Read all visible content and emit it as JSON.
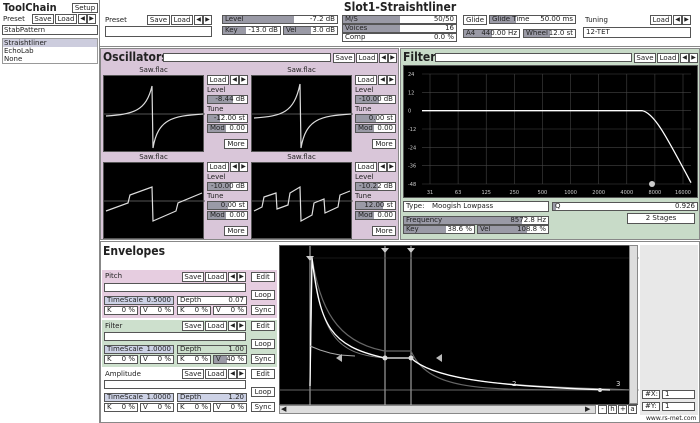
{
  "app": {
    "title": "ToolChain",
    "setup": "Setup",
    "preset_label": "Preset",
    "save": "Save",
    "load": "Load",
    "stab": "StabPattern",
    "list": [
      "Straishtliner",
      "EchoLab",
      "None"
    ],
    "url": "www.rs-met.com"
  },
  "slot": {
    "title": "Slot1-Straishtliner"
  },
  "top": {
    "preset_label": "Preset",
    "save": "Save",
    "load": "Load",
    "level": {
      "label": "Level",
      "value": "-7.2 dB",
      "fill": 0.62
    },
    "key": {
      "label": "Key",
      "value": "-13.0 dB",
      "fill": 0.4
    },
    "vel": {
      "label": "Vel",
      "value": "3.0 dB",
      "fill": 0.5
    },
    "ms": {
      "label": "M/S",
      "value": "50/50",
      "fill": 0.5
    },
    "voices": {
      "label": "Voices",
      "value": "16",
      "fill": 0.5
    },
    "comp": {
      "label": "Comp",
      "value": "0.0 %",
      "fill": 0.0
    },
    "glide": "Glide",
    "glide_time": {
      "label": "Glide Time",
      "value": "50.00 ms"
    },
    "a4": {
      "label": "A4",
      "value": "440.00 Hz"
    },
    "wheel": {
      "label": "Wheel",
      "value": "12.0 st"
    },
    "tuning": {
      "label": "Tuning",
      "value": "12-TET",
      "load": "Load"
    }
  },
  "osc": {
    "title": "Oscillators",
    "save": "Save",
    "load": "Load",
    "units": [
      {
        "file": "Saw.flac",
        "level": "-8.44 dB",
        "tune": "-12.00 st",
        "mod": "0.00"
      },
      {
        "file": "Saw.flac",
        "level": "-10.00 dB",
        "tune": "0.00 st",
        "mod": "0.00"
      },
      {
        "file": "Saw.flac",
        "level": "-10.00 dB",
        "tune": "0.00 st",
        "mod": "0.00"
      },
      {
        "file": "Saw.flac",
        "level": "-10.22 dB",
        "tune": "12.00 st",
        "mod": "0.00"
      }
    ],
    "load_label": "Load",
    "level_label": "Level",
    "tune_label": "Tune",
    "mod_label": "Mod",
    "more": "More"
  },
  "filter": {
    "title": "Filter",
    "save": "Save",
    "load": "Load",
    "y_ticks": [
      "24",
      "12",
      "0",
      "-12",
      "-24",
      "-36",
      "-48"
    ],
    "x_ticks": [
      "31",
      "63",
      "125",
      "250",
      "500",
      "1000",
      "2000",
      "4000",
      "8000",
      "16000"
    ],
    "type": {
      "label": "Type:",
      "value": "Moogish Lowpass"
    },
    "q": {
      "label": "Q",
      "value": "0.926",
      "fill": 0.02
    },
    "frequency": {
      "label": "Frequency",
      "value": "8572.8 Hz"
    },
    "key": {
      "label": "Key",
      "value": "38.6 %"
    },
    "vel": {
      "label": "Vel",
      "value": "108.8 %"
    },
    "stages": "2 Stages"
  },
  "env": {
    "title": "Envelopes",
    "edit": "Edit",
    "loop": "Loop",
    "sync": "Sync",
    "save": "Save",
    "load": "Load",
    "ts_label": "TimeScale",
    "depth_label": "Depth",
    "k_label": "K",
    "v_label": "V",
    "items": [
      {
        "name": "Pitch",
        "ts": "0.5000",
        "depth": "0.07",
        "k1": "0 %",
        "v1": "0 %",
        "k2": "0 %",
        "v2": "0 %"
      },
      {
        "name": "Filter",
        "ts": "1.0000",
        "depth": "1.00",
        "k1": "0 %",
        "v1": "0 %",
        "k2": "0 %",
        "v2": "40 %"
      },
      {
        "name": "Amplitude",
        "ts": "1.0000",
        "depth": "1.20",
        "k1": "0 %",
        "v1": "0 %",
        "k2": "0 %",
        "v2": "0 %"
      }
    ],
    "markers": [
      "2",
      "3"
    ],
    "nav": [
      "-",
      "h",
      "+",
      "a"
    ],
    "grid_x": {
      "label": "#X:",
      "value": "1"
    },
    "grid_y": {
      "label": "#Y:",
      "value": "1"
    }
  },
  "colors": {
    "osc": "#d9c6d9",
    "filter": "#c8dbc8",
    "env_pink": "#e6cde0",
    "env_green": "#cde0cd",
    "env_blue": "#cdd2e6",
    "slider": "#9a9aa6"
  }
}
